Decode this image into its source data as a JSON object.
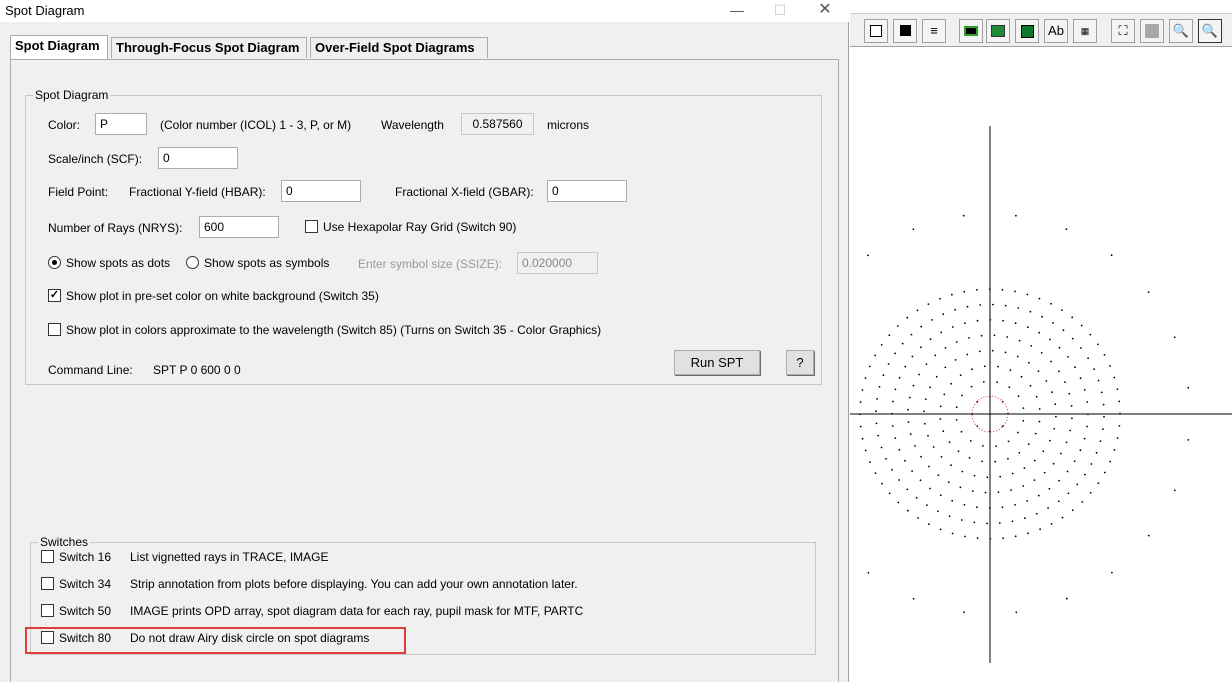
{
  "window": {
    "title": "Spot Diagram"
  },
  "tabs": [
    {
      "label": "Spot Diagram"
    },
    {
      "label": "Through-Focus Spot Diagram"
    },
    {
      "label": "Over-Field Spot Diagrams"
    }
  ],
  "spot_group": {
    "label": "Spot Diagram",
    "color": {
      "label": "Color:",
      "value": "P",
      "hint": "(Color number (ICOL) 1 - 3, P, or M)"
    },
    "wavelength": {
      "label": "Wavelength",
      "value": "0.587560",
      "unit": "microns"
    },
    "scale": {
      "label": "Scale/inch (SCF):",
      "value": "0"
    },
    "field_point": {
      "label": "Field Point:",
      "y_label": "Fractional Y-field (HBAR):",
      "y_value": "0",
      "x_label": "Fractional X-field (GBAR):",
      "x_value": "0"
    },
    "rays": {
      "label": "Number of Rays (NRYS):",
      "value": "600"
    },
    "hexapolar": {
      "label": "Use Hexapolar Ray Grid (Switch 90)",
      "checked": false
    },
    "dots": {
      "label": "Show spots as dots",
      "selected": true
    },
    "symbols": {
      "label": "Show spots as symbols",
      "selected": false
    },
    "ssize": {
      "label": "Enter symbol size (SSIZE):",
      "value": "0.020000"
    },
    "preset_color": {
      "label": "Show plot in pre-set color on white background (Switch 35)",
      "checked": true
    },
    "wave_color": {
      "label": "Show plot in colors approximate to the wavelength (Switch 85) (Turns on Switch 35 - Color Graphics)",
      "checked": false
    },
    "command": {
      "label": "Command Line:",
      "value": "SPT P 0 600 0 0"
    },
    "run_button": "Run SPT",
    "help_button": "?"
  },
  "switches": {
    "label": "Switches",
    "items": [
      {
        "name": "Switch 16",
        "desc": "List vignetted rays in TRACE, IMAGE",
        "checked": false
      },
      {
        "name": "Switch 34",
        "desc": "Strip annotation from plots before displaying. You can add your own annotation later.",
        "checked": false
      },
      {
        "name": "Switch 50",
        "desc": "IMAGE prints OPD array, spot diagram data for each ray, pupil mask for MTF, PARTC",
        "checked": false
      },
      {
        "name": "Switch 80",
        "desc": "Do not draw Airy disk circle on spot diagrams",
        "checked": false
      }
    ]
  },
  "toolbar": {
    "text_button": "Ab",
    "icons": [
      "white-box-icon",
      "black-box-icon",
      "line-weight-icon",
      "camera-icon",
      "picture-icon",
      "save-icon",
      "text-icon",
      "grid-scale-icon",
      "fit-icon",
      "gray-box-icon",
      "zoom-in-icon",
      "zoom-out-icon"
    ]
  },
  "colors": {
    "highlight": "#e03c3c",
    "spot_dots": "#000000",
    "airy_disk": "#cc3333"
  }
}
